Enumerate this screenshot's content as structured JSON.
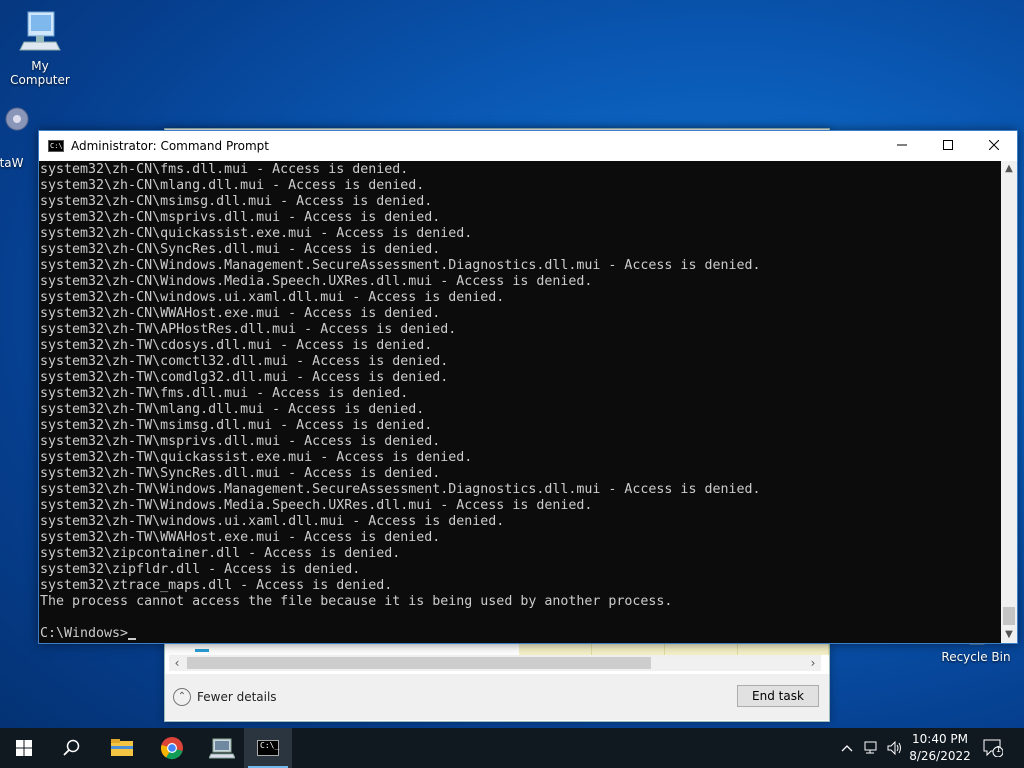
{
  "desktop": {
    "icons": [
      {
        "label": "My Computer"
      },
      {
        "label": "DataW"
      },
      {
        "label": "Recycle Bin"
      }
    ]
  },
  "task_manager": {
    "fewer_details_label": "Fewer details",
    "end_task_label": "End task"
  },
  "cmd": {
    "title": "Administrator: Command Prompt",
    "lines": [
      "system32\\zh-CN\\fms.dll.mui - Access is denied.",
      "system32\\zh-CN\\mlang.dll.mui - Access is denied.",
      "system32\\zh-CN\\msimsg.dll.mui - Access is denied.",
      "system32\\zh-CN\\msprivs.dll.mui - Access is denied.",
      "system32\\zh-CN\\quickassist.exe.mui - Access is denied.",
      "system32\\zh-CN\\SyncRes.dll.mui - Access is denied.",
      "system32\\zh-CN\\Windows.Management.SecureAssessment.Diagnostics.dll.mui - Access is denied.",
      "system32\\zh-CN\\Windows.Media.Speech.UXRes.dll.mui - Access is denied.",
      "system32\\zh-CN\\windows.ui.xaml.dll.mui - Access is denied.",
      "system32\\zh-CN\\WWAHost.exe.mui - Access is denied.",
      "system32\\zh-TW\\APHostRes.dll.mui - Access is denied.",
      "system32\\zh-TW\\cdosys.dll.mui - Access is denied.",
      "system32\\zh-TW\\comctl32.dll.mui - Access is denied.",
      "system32\\zh-TW\\comdlg32.dll.mui - Access is denied.",
      "system32\\zh-TW\\fms.dll.mui - Access is denied.",
      "system32\\zh-TW\\mlang.dll.mui - Access is denied.",
      "system32\\zh-TW\\msimsg.dll.mui - Access is denied.",
      "system32\\zh-TW\\msprivs.dll.mui - Access is denied.",
      "system32\\zh-TW\\quickassist.exe.mui - Access is denied.",
      "system32\\zh-TW\\SyncRes.dll.mui - Access is denied.",
      "system32\\zh-TW\\Windows.Management.SecureAssessment.Diagnostics.dll.mui - Access is denied.",
      "system32\\zh-TW\\Windows.Media.Speech.UXRes.dll.mui - Access is denied.",
      "system32\\zh-TW\\windows.ui.xaml.dll.mui - Access is denied.",
      "system32\\zh-TW\\WWAHost.exe.mui - Access is denied.",
      "system32\\zipcontainer.dll - Access is denied.",
      "system32\\zipfldr.dll - Access is denied.",
      "system32\\ztrace_maps.dll - Access is denied.",
      "The process cannot access the file because it is being used by another process."
    ],
    "prompt": "C:\\Windows>"
  },
  "taskbar": {
    "apps": [
      "start-icon",
      "search-icon",
      "file-explorer-icon",
      "chrome-icon",
      "computer-app-icon",
      "command-prompt-icon"
    ],
    "time": "10:40 PM",
    "date": "8/26/2022",
    "notification_count": "1"
  }
}
